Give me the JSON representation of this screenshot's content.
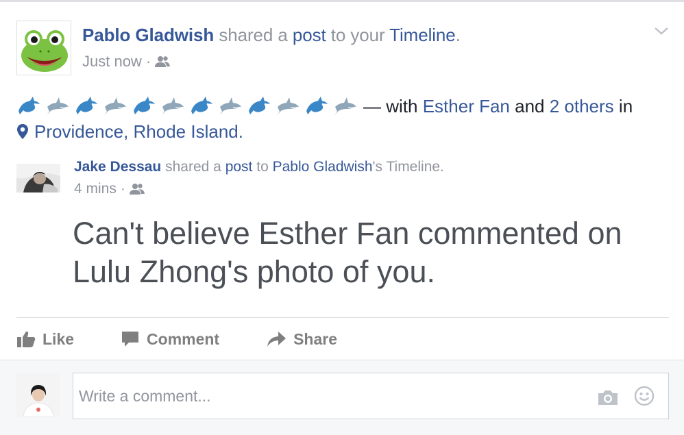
{
  "post": {
    "author": "Pablo Gladwish",
    "shared_a": "shared a",
    "post_link": "post",
    "to_your": "to your",
    "timeline_link": "Timeline",
    "period": ".",
    "time": "Just now",
    "sep": "·",
    "privacy_icon": "friends-icon"
  },
  "body": {
    "with_text": "— with",
    "tag_person": "Esther Fan",
    "and_text": "and",
    "others_link": "2 others",
    "in_text": "in",
    "location": "Providence, Rhode Island."
  },
  "shared": {
    "author": "Jake Dessau",
    "shared_a": "shared a",
    "post_link": "post",
    "to_text": "to",
    "target": "Pablo Gladwish",
    "suffix": "'s Timeline.",
    "time": "4 mins",
    "sep": "·",
    "message": "Can't believe Esther Fan commented on Lulu Zhong's photo of you."
  },
  "actions": {
    "like": "Like",
    "comment": "Comment",
    "share": "Share"
  },
  "comment": {
    "placeholder": "Write a comment..."
  },
  "colors": {
    "link": "#365899",
    "muted": "#90949c",
    "action": "#7f7f7f"
  }
}
